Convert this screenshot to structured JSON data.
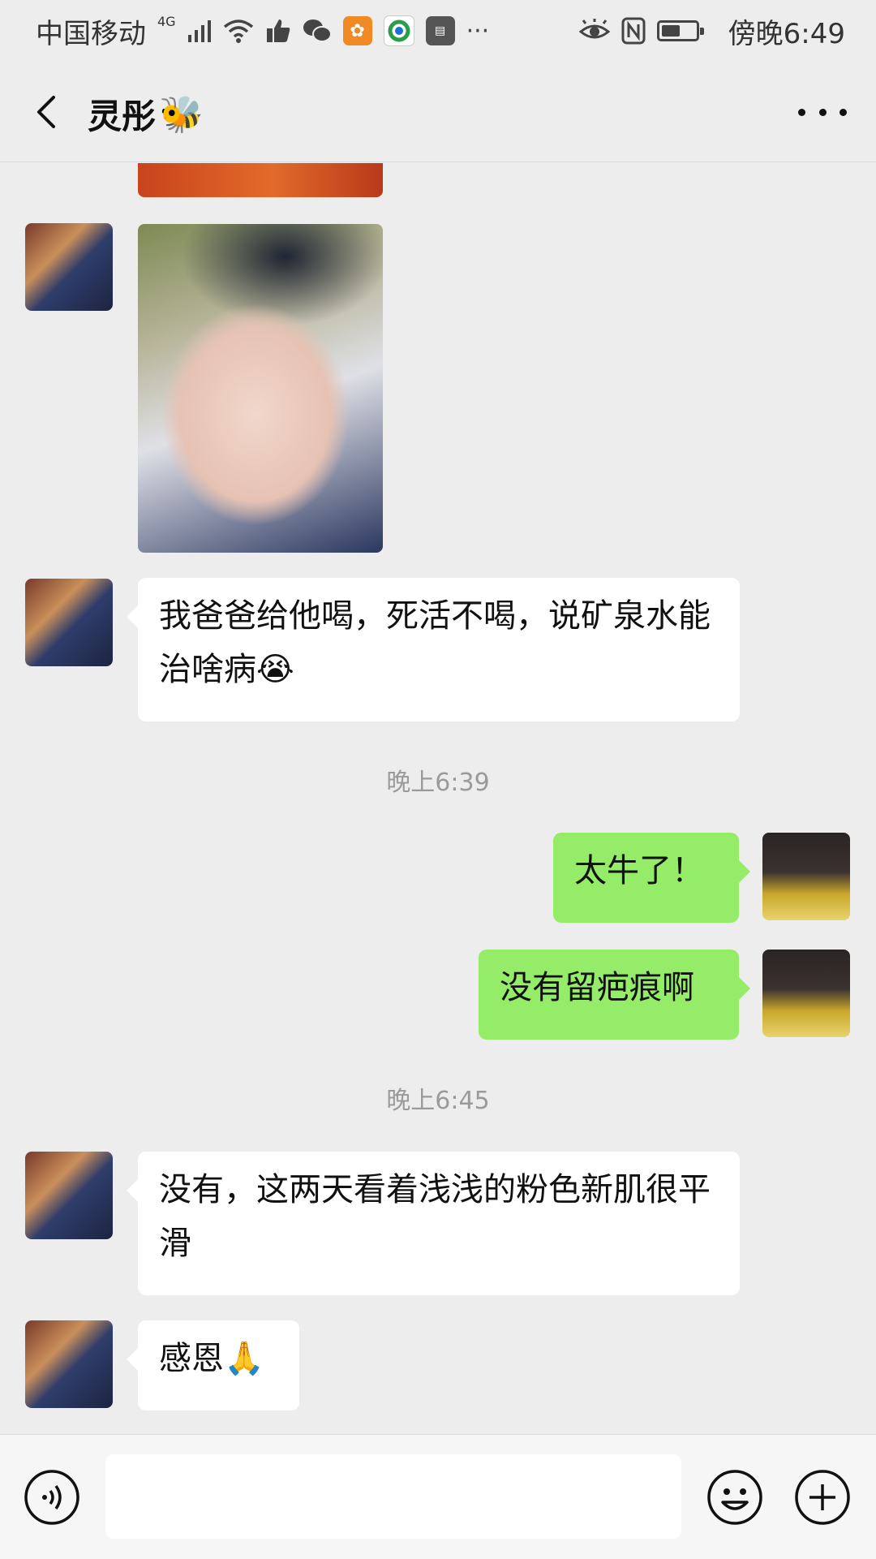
{
  "status_bar": {
    "carrier": "中国移动",
    "network": "4G",
    "time": "傍晚6:49"
  },
  "header": {
    "title": "灵彤",
    "title_emoji": "🐝",
    "back_icon": "chevron-left-icon",
    "more_icon": "more-dots-icon"
  },
  "messages": {
    "m1": {
      "text": "我爸爸给他喝，死活不喝，说矿泉水能治啥病",
      "emoji": "😭"
    },
    "ts1": "晚上6:39",
    "m2": {
      "text": "太牛了！"
    },
    "m3": {
      "text": "没有留疤痕啊"
    },
    "ts2": "晚上6:45",
    "m4": {
      "text": "没有，这两天看着浅浅的粉色新肌很平滑"
    },
    "m5": {
      "text": "感恩",
      "emoji": "🙏"
    }
  },
  "input_bar": {
    "value": "",
    "voice_icon": "voice-icon",
    "emoji_icon": "emoji-icon",
    "plus_icon": "plus-icon"
  },
  "colors": {
    "background": "#ededed",
    "bubble_self": "#95ec69",
    "bubble_other": "#ffffff",
    "timestamp": "#9a9a9a"
  }
}
